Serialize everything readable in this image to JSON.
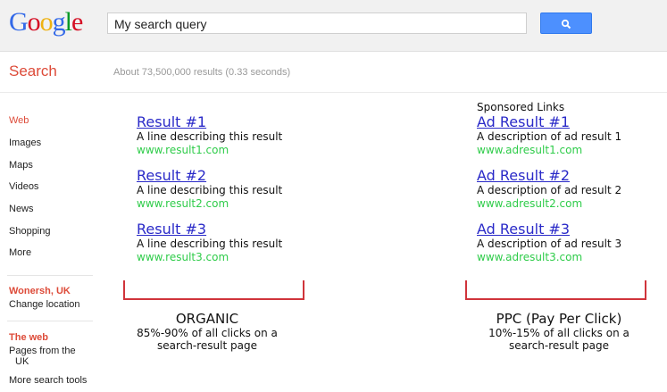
{
  "header": {
    "logo": "Google",
    "logo_letters": [
      [
        "G",
        "#3369e8"
      ],
      [
        "o",
        "#d50f25"
      ],
      [
        "o",
        "#eeb211"
      ],
      [
        "g",
        "#3369e8"
      ],
      [
        "l",
        "#009925"
      ],
      [
        "e",
        "#d50f25"
      ]
    ],
    "query": "My search query",
    "search_button_icon": "magnifier-icon"
  },
  "subheader": {
    "label": "Search",
    "stats": "About 73,500,000 results (0.33 seconds)"
  },
  "sidebar": {
    "items": [
      "Web",
      "Images",
      "Maps",
      "Videos",
      "News",
      "Shopping",
      "More"
    ],
    "location": "Wonersh, UK",
    "change_location": "Change location",
    "web_label": "The web",
    "pages_from": "Pages from the",
    "pages_from_2": "UK",
    "more_tools": "More search tools"
  },
  "organic": [
    {
      "title": "Result #1",
      "desc": "A line describing this result",
      "url": "www.result1.com"
    },
    {
      "title": "Result #2",
      "desc": "A line describing this result",
      "url": "www.result2.com"
    },
    {
      "title": "Result #3",
      "desc": "A line describing this result",
      "url": "www.result3.com"
    }
  ],
  "ads": {
    "heading": "Sponsored Links",
    "items": [
      {
        "title": "Ad Result #1",
        "desc": "A description of ad result 1",
        "url": "www.adresult1.com"
      },
      {
        "title": "Ad Result #2",
        "desc": "A description of ad result 2",
        "url": "www.adresult2.com"
      },
      {
        "title": "Ad Result #3",
        "desc": "A description of ad result 3",
        "url": "www.adresult3.com"
      }
    ]
  },
  "annotations": {
    "organic": {
      "title": "ORGANIC",
      "line1": "85%-90% of all clicks on a",
      "line2": "search-result page"
    },
    "ppc": {
      "title": "PPC (Pay Per Click)",
      "line1": "10%-15% of all clicks on a",
      "line2": "search-result page"
    }
  }
}
